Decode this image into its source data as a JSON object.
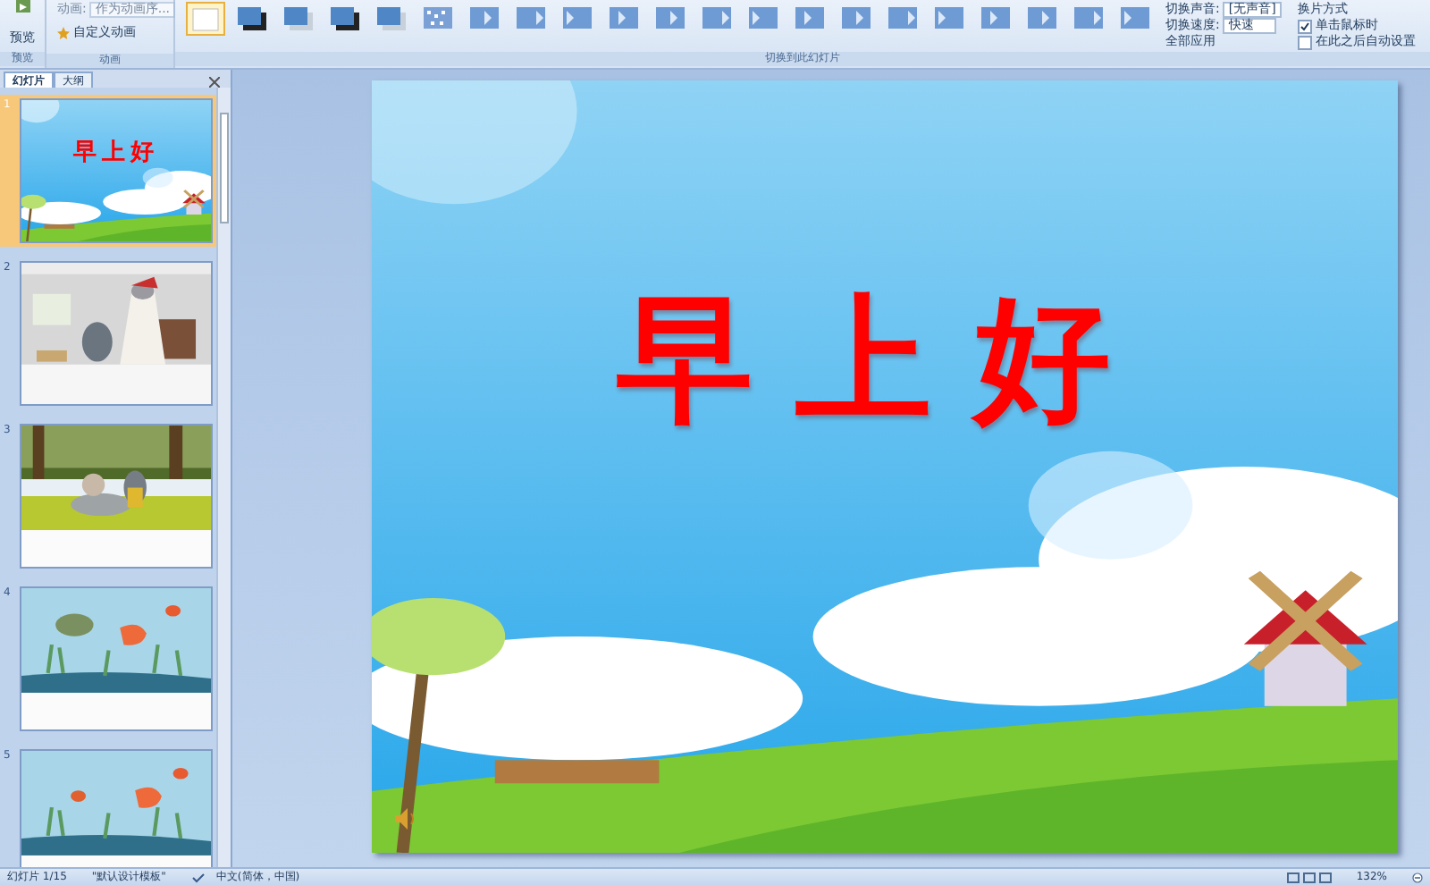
{
  "ribbon": {
    "preview_button": "预览",
    "animation_label": "动画:",
    "animation_value": "作为动画序...",
    "custom_animation": "自定义动画",
    "groups": [
      "预览",
      "动画",
      "切换到此幻灯片"
    ],
    "transitions": [
      {
        "selected": true
      },
      {
        "selected": false
      },
      {
        "selected": false
      },
      {
        "selected": false
      },
      {
        "selected": false
      },
      {
        "selected": false
      },
      {
        "selected": false
      },
      {
        "selected": false
      },
      {
        "selected": false
      },
      {
        "selected": false
      },
      {
        "selected": false
      },
      {
        "selected": false
      },
      {
        "selected": false
      },
      {
        "selected": false
      },
      {
        "selected": false
      },
      {
        "selected": false
      },
      {
        "selected": false
      },
      {
        "selected": false
      },
      {
        "selected": false
      },
      {
        "selected": false
      },
      {
        "selected": false
      }
    ],
    "sound_label": "切换声音:",
    "sound_value": "[无声音]",
    "speed_label": "切换速度:",
    "speed_value": "快速",
    "apply_all": "全部应用",
    "advance_title": "换片方式",
    "options": [
      {
        "label": "单击鼠标时",
        "checked": true
      },
      {
        "label": "在此之后自动设置",
        "checked": false
      }
    ]
  },
  "panel": {
    "tabs": [
      {
        "label": "幻灯片",
        "selected": true
      },
      {
        "label": "大纲",
        "selected": false
      }
    ],
    "slides": [
      {
        "number": "1",
        "selected": true,
        "title": "早上好"
      },
      {
        "number": "2",
        "selected": false,
        "kind": "picture"
      },
      {
        "number": "3",
        "selected": false,
        "kind": "picture"
      },
      {
        "number": "4",
        "selected": false,
        "kind": "picture"
      },
      {
        "number": "5",
        "selected": false,
        "kind": "picture"
      }
    ]
  },
  "slide": {
    "title": "早上好"
  },
  "status": {
    "slide_count": "幻灯片 1/15",
    "theme": "\"默认设计模板\"",
    "language": "中文(简体，中国)",
    "zoom": "132%"
  }
}
